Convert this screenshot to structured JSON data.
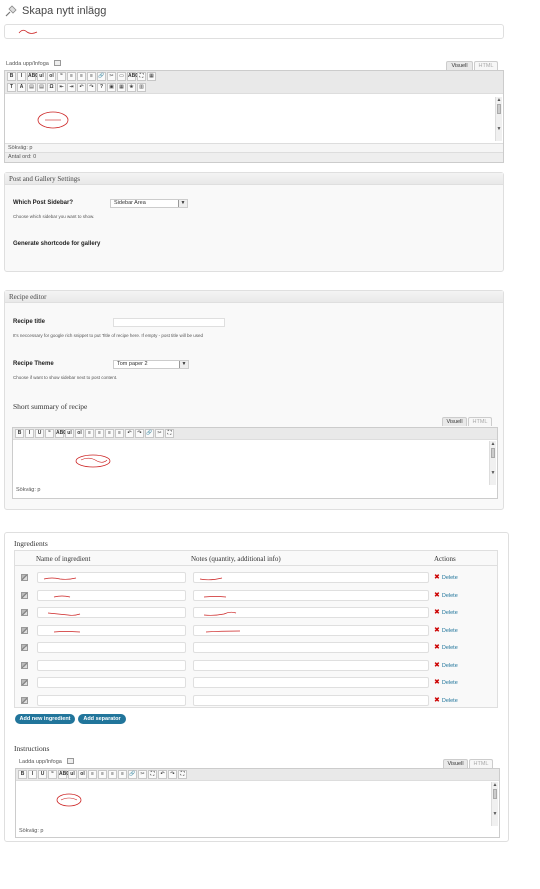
{
  "header": {
    "title": "Skapa nytt inlägg",
    "icon": "pushpin-icon"
  },
  "main_editor": {
    "upload_label": "Ladda upp/Infoga",
    "tab_visual": "Visuell",
    "tab_html": "HTML",
    "path_label": "Sökväg: p",
    "word_count": "Antal ord: 0",
    "toolbar_row1": [
      "B",
      "I",
      "ABC",
      "ul",
      "ol",
      "“",
      "≡",
      "≡",
      "≡",
      "🔗",
      "✂",
      "▭",
      "ABC",
      "⛶",
      "▦"
    ],
    "toolbar_row2": [
      "T",
      "A",
      "▤",
      "▤",
      "Ω",
      "⇤",
      "⇥",
      "↶",
      "↷",
      "?",
      "▣",
      "▦",
      "❀",
      "▥"
    ]
  },
  "post_gallery": {
    "header": "Post and Gallery Settings",
    "sidebar_label": "Which Post Sidebar?",
    "sidebar_value": "Sidebar Area",
    "sidebar_help": "Choose which sidebar you want to show.",
    "shortcode_label": "Generate shortcode for gallery"
  },
  "recipe_editor": {
    "header": "Recipe editor",
    "title_label": "Recipe title",
    "title_help": "It's neccessary for google rich snippet to put Title of recipe here. If empty - post title will be used",
    "theme_label": "Recipe Theme",
    "theme_value": "Tom paper 2",
    "theme_help": "Choose if want to show sidebar next to post content.",
    "summary_label": "Short summary of recipe",
    "tab_visual": "Visuell",
    "tab_html": "HTML",
    "path_label": "Sökväg: p",
    "toolbar": [
      "B",
      "I",
      "U",
      "“",
      "ABC",
      "ul",
      "ol",
      "≡",
      "≡",
      "≡",
      "≡",
      "↶",
      "↷",
      "🔗",
      "✂",
      "⛶"
    ]
  },
  "ingredients": {
    "header": "Ingredients",
    "col_name": "Name of ingredient",
    "col_notes": "Notes (quantity, additional info)",
    "col_actions": "Actions",
    "delete_label": "Delete",
    "rows": [
      {
        "filled": true
      },
      {
        "filled": true
      },
      {
        "filled": true
      },
      {
        "filled": true
      },
      {
        "filled": false
      },
      {
        "filled": false
      },
      {
        "filled": false
      },
      {
        "filled": false
      }
    ],
    "add_ingredient": "Add new ingredient",
    "add_separator": "Add separator"
  },
  "instructions": {
    "header": "Instructions",
    "upload_label": "Ladda upp/Infoga",
    "tab_visual": "Visuell",
    "tab_html": "HTML",
    "path_label": "Sökväg: p",
    "toolbar": [
      "B",
      "I",
      "U",
      "“",
      "ABC",
      "ul",
      "ol",
      "≡",
      "≡",
      "≡",
      "≡",
      "🔗",
      "✂",
      "⛶",
      "↶",
      "↷",
      "⛶"
    ]
  }
}
